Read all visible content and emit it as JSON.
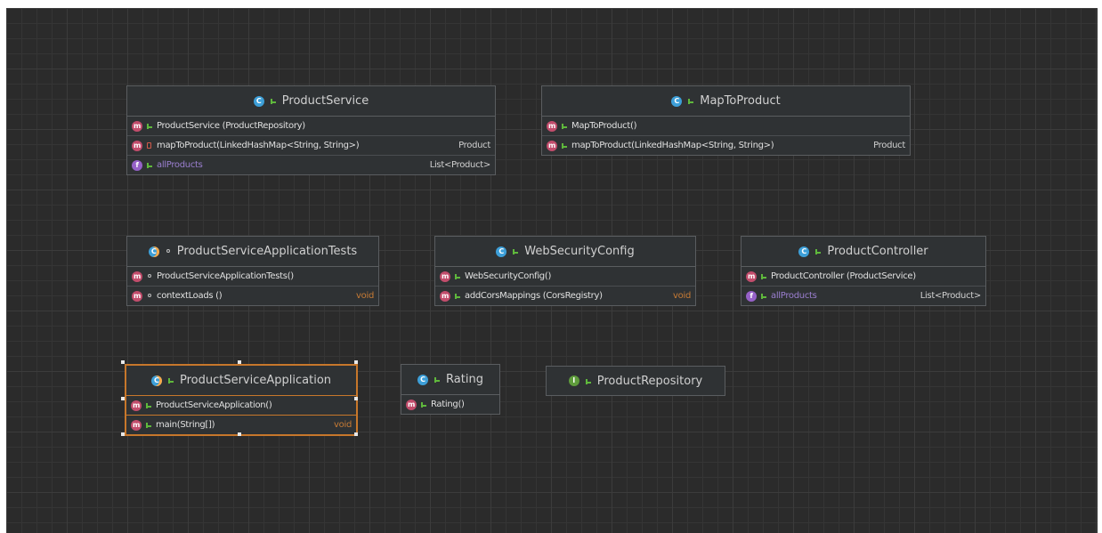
{
  "diagram": {
    "classes": [
      {
        "id": "ProductService",
        "kind": "class",
        "title": "ProductService",
        "rows": [
          {
            "kind": "constructor",
            "visibility": "public",
            "name": "ProductService (ProductRepository)",
            "type": ""
          },
          {
            "kind": "method",
            "visibility": "private",
            "name": "mapToProduct(LinkedHashMap<String, String>)",
            "type": "Product"
          },
          {
            "kind": "field",
            "visibility": "public",
            "name": "allProducts",
            "type": "List<Product>"
          }
        ]
      },
      {
        "id": "MapToProduct",
        "kind": "class",
        "title": "MapToProduct",
        "rows": [
          {
            "kind": "constructor",
            "visibility": "public",
            "name": "MapToProduct()",
            "type": ""
          },
          {
            "kind": "method",
            "visibility": "public",
            "name": "mapToProduct(LinkedHashMap<String, String>)",
            "type": "Product"
          }
        ]
      },
      {
        "id": "ProductServiceApplicationTests",
        "kind": "test-class",
        "title": "ProductServiceApplicationTests",
        "rows": [
          {
            "kind": "constructor",
            "visibility": "package",
            "name": "ProductServiceApplicationTests()",
            "type": ""
          },
          {
            "kind": "method",
            "visibility": "package",
            "name": "contextLoads ()",
            "type": "void"
          }
        ]
      },
      {
        "id": "WebSecurityConfig",
        "kind": "class",
        "title": "WebSecurityConfig",
        "rows": [
          {
            "kind": "constructor",
            "visibility": "public",
            "name": "WebSecurityConfig()",
            "type": ""
          },
          {
            "kind": "method",
            "visibility": "public",
            "name": "addCorsMappings (CorsRegistry)",
            "type": "void"
          }
        ]
      },
      {
        "id": "ProductController",
        "kind": "class",
        "title": "ProductController",
        "rows": [
          {
            "kind": "constructor",
            "visibility": "public",
            "name": "ProductController (ProductService)",
            "type": ""
          },
          {
            "kind": "field",
            "visibility": "public",
            "name": "allProducts",
            "type": "List<Product>"
          }
        ]
      },
      {
        "id": "ProductServiceApplication",
        "kind": "test-class",
        "title": "ProductServiceApplication",
        "selected": true,
        "rows": [
          {
            "kind": "constructor",
            "visibility": "public",
            "name": "ProductServiceApplication()",
            "type": ""
          },
          {
            "kind": "method",
            "visibility": "public",
            "name": "main(String[])",
            "type": "void"
          }
        ]
      },
      {
        "id": "Rating",
        "kind": "class",
        "title": "Rating",
        "rows": [
          {
            "kind": "constructor",
            "visibility": "public",
            "name": "Rating()",
            "type": ""
          }
        ]
      },
      {
        "id": "ProductRepository",
        "kind": "interface",
        "title": "ProductRepository",
        "rows": []
      }
    ],
    "colors": {
      "background": "#2b2b2b",
      "selection": "#c7772b",
      "class_icon": "#3d9fd8",
      "interface_icon": "#5f9c3c",
      "method_icon": "#c24d6c",
      "field_icon": "#9661c8",
      "void_type": "#c77b35"
    }
  }
}
